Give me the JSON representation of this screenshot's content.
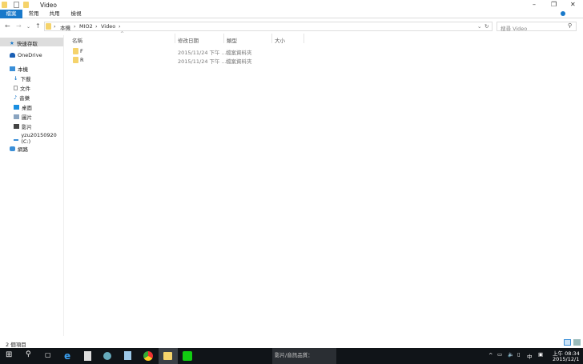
{
  "window": {
    "title": "Video",
    "minimize": "–",
    "restore": "❐",
    "close": "✕"
  },
  "ribbon": {
    "tabs": [
      "檔案",
      "常用",
      "共用",
      "檢視"
    ]
  },
  "address": {
    "crumbs": [
      "本機",
      "MIO2",
      "Video"
    ]
  },
  "search": {
    "placeholder": "搜尋 Video"
  },
  "sidebar": {
    "items": [
      {
        "label": "快速存取",
        "icon": "star-icon"
      },
      {
        "label": "OneDrive",
        "icon": "cloud-icon"
      },
      {
        "label": "本機",
        "icon": "computer-icon"
      },
      {
        "label": "下載",
        "icon": "download-icon"
      },
      {
        "label": "文件",
        "icon": "document-icon"
      },
      {
        "label": "音樂",
        "icon": "music-icon"
      },
      {
        "label": "桌面",
        "icon": "desktop-icon"
      },
      {
        "label": "圖片",
        "icon": "pictures-icon"
      },
      {
        "label": "影片",
        "icon": "videos-icon"
      },
      {
        "label": "yzu20150920 (C:)",
        "icon": "drive-icon"
      },
      {
        "label": "網路",
        "icon": "network-icon"
      }
    ]
  },
  "columns": [
    "名稱",
    "修改日期",
    "類型",
    "大小"
  ],
  "files": [
    {
      "name": "F",
      "date": "2015/11/24 下午 ...",
      "type": "檔案資料夾"
    },
    {
      "name": "R",
      "date": "2015/11/24 下午 ...",
      "type": "檔案資料夾"
    }
  ],
  "status": {
    "count": "2 個項目"
  },
  "taskbar": {
    "popup": "影片/音訊品質：",
    "ime": "中",
    "time": "上午 08:34",
    "date": "2015/12/1"
  }
}
